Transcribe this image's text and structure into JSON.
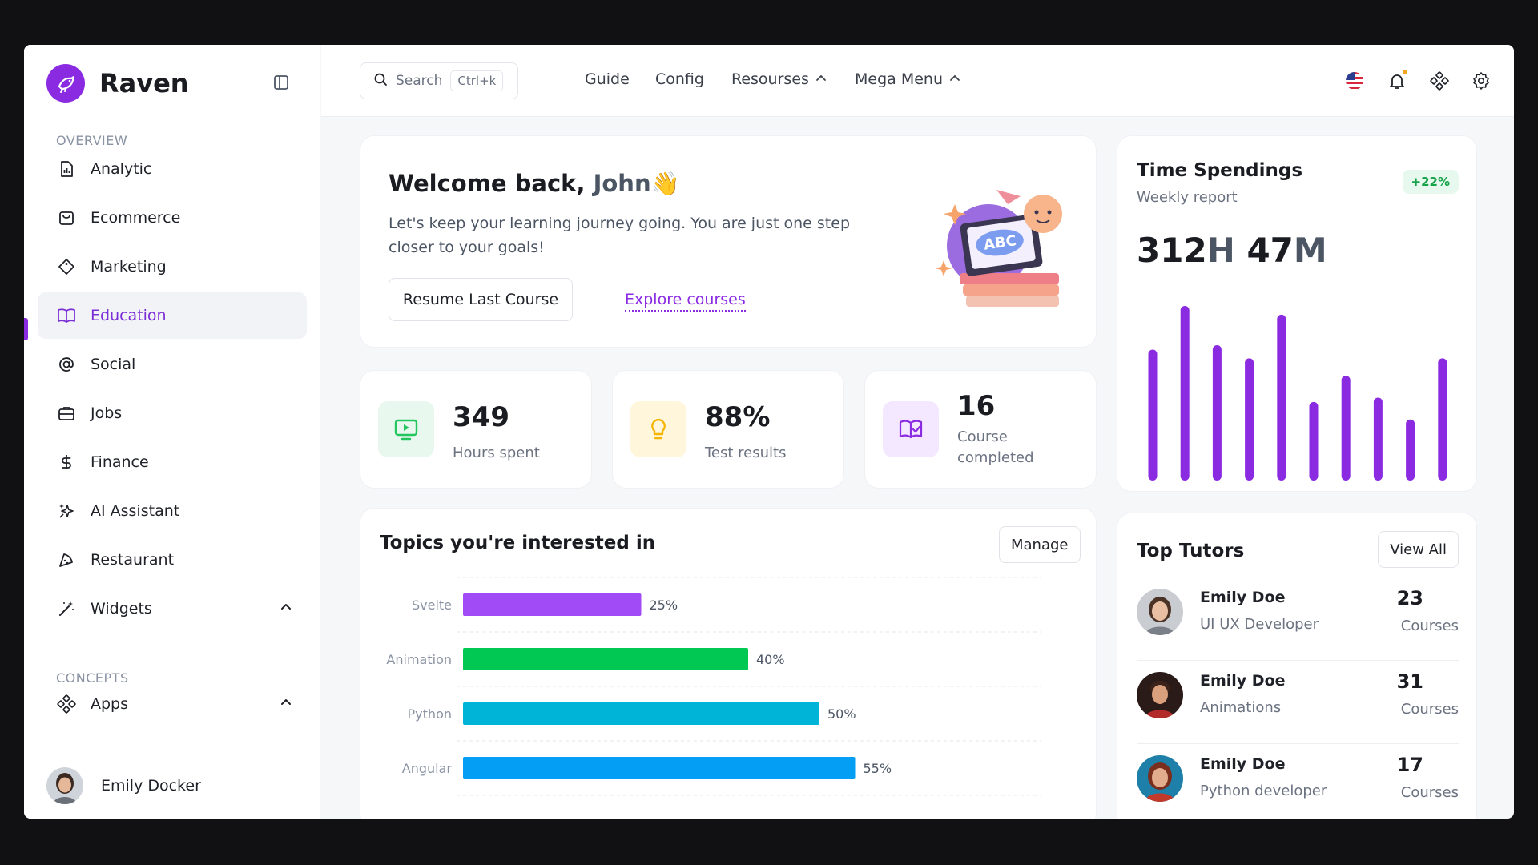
{
  "app": {
    "name": "Raven"
  },
  "sidebar": {
    "section_overview": "OVERVIEW",
    "section_concepts": "CONCEPTS",
    "items": [
      {
        "label": "Analytic",
        "icon": "analytics-doc-icon"
      },
      {
        "label": "Ecommerce",
        "icon": "shopping-bag-icon"
      },
      {
        "label": "Marketing",
        "icon": "tag-icon"
      },
      {
        "label": "Education",
        "icon": "book-open-icon",
        "active": true
      },
      {
        "label": "Social",
        "icon": "at-sign-icon"
      },
      {
        "label": "Jobs",
        "icon": "briefcase-icon"
      },
      {
        "label": "Finance",
        "icon": "dollar-icon"
      },
      {
        "label": "AI Assistant",
        "icon": "sparkles-icon"
      },
      {
        "label": "Restaurant",
        "icon": "pizza-slice-icon"
      },
      {
        "label": "Widgets",
        "icon": "magic-wand-icon"
      },
      {
        "label": "Apps",
        "icon": "apps-grid-icon"
      }
    ],
    "user": {
      "name": "Emily Docker"
    }
  },
  "header": {
    "search_label": "Search",
    "search_shortcut": "Ctrl+k",
    "nav": [
      "Guide",
      "Config",
      "Resourses",
      "Mega Menu"
    ]
  },
  "welcome": {
    "greeting": "Welcome back,",
    "name": "John",
    "wave": "👋",
    "text": "Let's keep your learning journey going. You are just one step closer to your goals!",
    "resume_button": "Resume Last Course",
    "explore_link": "Explore courses"
  },
  "stats": [
    {
      "value": "349",
      "label": "Hours spent",
      "color": "#22c55e",
      "bg": "#e8f8ee"
    },
    {
      "value": "88%",
      "label": "Test results",
      "color": "#f5b400",
      "bg": "#fff6dc"
    },
    {
      "value": "16",
      "label": "Course completed",
      "color": "#8a2be2",
      "bg": "#f3e8ff"
    }
  ],
  "topics": {
    "title": "Topics you're interested in",
    "manage_button": "Manage"
  },
  "time_spendings": {
    "title": "Time Spendings",
    "subtitle": "Weekly report",
    "badge": "+22%",
    "hours": "312",
    "hours_unit": "H",
    "minutes": "47",
    "minutes_unit": "M"
  },
  "tutors": {
    "title": "Top Tutors",
    "view_all": "View All",
    "list": [
      {
        "name": "Emily Doe",
        "role": "UI UX Developer",
        "count": "23",
        "count_label": "Courses"
      },
      {
        "name": "Emily Doe",
        "role": "Animations",
        "count": "31",
        "count_label": "Courses"
      },
      {
        "name": "Emily Doe",
        "role": "Python developer",
        "count": "17",
        "count_label": "Courses"
      }
    ]
  },
  "chart_data": [
    {
      "type": "bar",
      "orientation": "horizontal",
      "categories": [
        "Svelte",
        "Animation",
        "Python",
        "Angular"
      ],
      "values": [
        25,
        40,
        50,
        55
      ],
      "value_labels": [
        "25%",
        "40%",
        "50%",
        "55%"
      ],
      "colors": [
        "#a04bf5",
        "#00c853",
        "#00b4d8",
        "#049ef4"
      ],
      "xlim": [
        0,
        80
      ],
      "grid": true
    },
    {
      "type": "bar",
      "categories": [
        "",
        "",
        "",
        "",
        "",
        "",
        "",
        "",
        "",
        ""
      ],
      "values": [
        60,
        80,
        62,
        56,
        76,
        36,
        48,
        38,
        28,
        56
      ],
      "ylim": [
        0,
        80
      ],
      "color": "#8a2be2",
      "grid": false
    }
  ]
}
